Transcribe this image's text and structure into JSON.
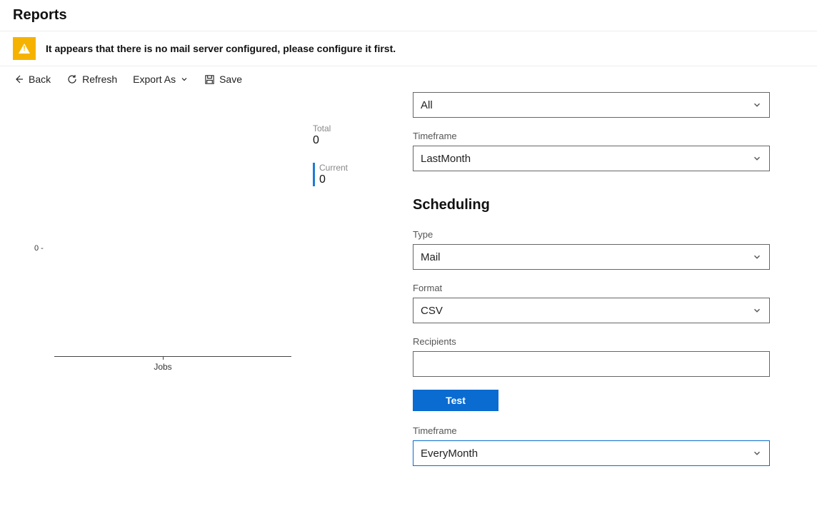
{
  "page_title": "Reports",
  "warning": "It appears that there is no mail server configured, please configure it first.",
  "toolbar": {
    "back": "Back",
    "refresh": "Refresh",
    "export_as": "Export As",
    "save": "Save"
  },
  "metrics": {
    "total_label": "Total",
    "total_value": "0",
    "current_label": "Current",
    "current_value": "0"
  },
  "filters": {
    "scope_value": "All",
    "timeframe_label": "Timeframe",
    "timeframe_value": "LastMonth"
  },
  "scheduling": {
    "title": "Scheduling",
    "type_label": "Type",
    "type_value": "Mail",
    "format_label": "Format",
    "format_value": "CSV",
    "recipients_label": "Recipients",
    "recipients_value": "",
    "test_button": "Test",
    "sched_timeframe_label": "Timeframe",
    "sched_timeframe_value": "EveryMonth"
  },
  "chart_data": {
    "type": "bar",
    "categories": [
      "Jobs"
    ],
    "values": [
      0
    ],
    "title": "",
    "xlabel": "Jobs",
    "ylabel": "",
    "ylim": [
      0,
      0
    ],
    "y0_tick": "0 -",
    "x_axis_label": "Jobs"
  }
}
